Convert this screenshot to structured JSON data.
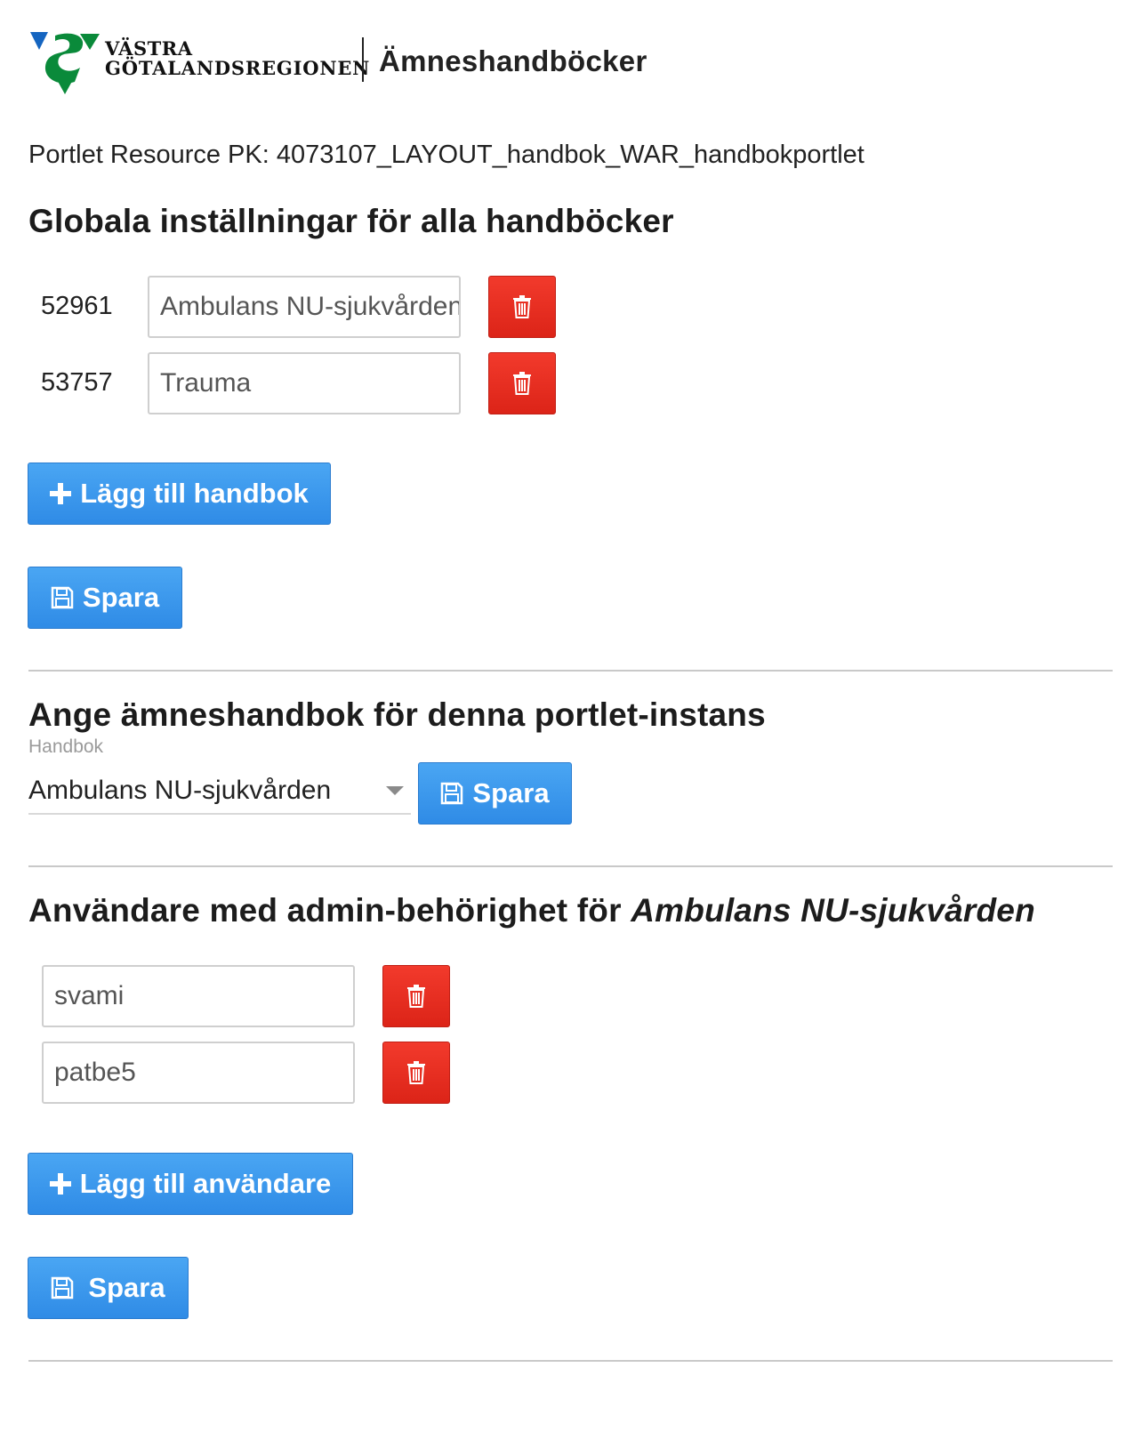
{
  "header": {
    "org_line1": "VÄSTRA",
    "org_line2": "GÖTALANDSREGIONEN",
    "app_title": "Ämneshandböcker",
    "brand_colors": {
      "green": "#0a8a3a",
      "blue": "#1565c0"
    }
  },
  "portlet_pk": "Portlet Resource PK: 4073107_LAYOUT_handbok_WAR_handbokportlet",
  "global": {
    "heading": "Globala inställningar för alla handböcker",
    "handbooks": [
      {
        "id": "52961",
        "name": "Ambulans NU-sjukvården"
      },
      {
        "id": "53757",
        "name": "Trauma"
      }
    ],
    "add_label": "Lägg till handbok",
    "save_label": "Spara"
  },
  "instance": {
    "heading": "Ange ämneshandbok för denna portlet-instans",
    "select_label": "Handbok",
    "selected": "Ambulans NU-sjukvården",
    "save_label": "Spara"
  },
  "admins": {
    "heading_prefix": "Användare med admin-behörighet för ",
    "heading_handbook": "Ambulans NU-sjukvården",
    "users": [
      "svami",
      "patbe5"
    ],
    "add_label": "Lägg till användare",
    "save_label": "Spara"
  },
  "icons": {
    "delete": "trash-icon",
    "add": "plus-icon",
    "save": "floppy-disk-icon",
    "dropdown": "caret-down-icon"
  },
  "colors": {
    "primary": "#3a97ec",
    "danger": "#e52c1f"
  }
}
